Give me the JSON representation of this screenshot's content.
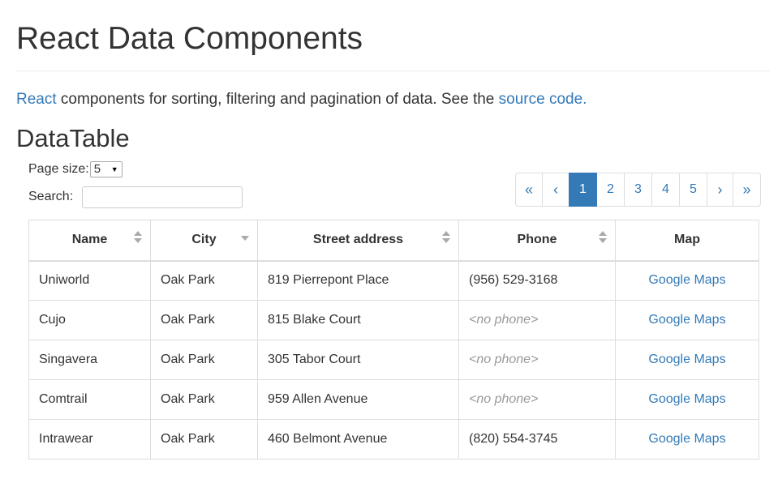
{
  "header": {
    "title": "React Data Components"
  },
  "intro": {
    "react_link": "React",
    "text": " components for sorting, filtering and pagination of data. See the ",
    "source_link": "source code."
  },
  "section": {
    "title": "DataTable"
  },
  "controls": {
    "page_size_label": "Page size:",
    "page_size_value": "5",
    "search_label": "Search:",
    "search_value": ""
  },
  "pagination": {
    "first": "«",
    "prev": "‹",
    "pages": [
      "1",
      "2",
      "3",
      "4",
      "5"
    ],
    "active_page": "1",
    "next": "›",
    "last": "»"
  },
  "table": {
    "columns": [
      {
        "label": "Name",
        "sort": "both"
      },
      {
        "label": "City",
        "sort": "descending"
      },
      {
        "label": "Street address",
        "sort": "both"
      },
      {
        "label": "Phone",
        "sort": "both"
      },
      {
        "label": "Map",
        "sort": "none"
      }
    ],
    "rows": [
      {
        "name": "Uniworld",
        "city": "Oak Park",
        "street": "819 Pierrepont Place",
        "phone": "(956) 529-3168",
        "map": "Google Maps"
      },
      {
        "name": "Cujo",
        "city": "Oak Park",
        "street": "815 Blake Court",
        "phone": "<no phone>",
        "map": "Google Maps"
      },
      {
        "name": "Singavera",
        "city": "Oak Park",
        "street": "305 Tabor Court",
        "phone": "<no phone>",
        "map": "Google Maps"
      },
      {
        "name": "Comtrail",
        "city": "Oak Park",
        "street": "959 Allen Avenue",
        "phone": "<no phone>",
        "map": "Google Maps"
      },
      {
        "name": "Intrawear",
        "city": "Oak Park",
        "street": "460 Belmont Avenue",
        "phone": "(820) 554-3745",
        "map": "Google Maps"
      }
    ]
  },
  "colors": {
    "link": "#337ab7",
    "active_page_bg": "#337ab7",
    "border": "#dddddd",
    "muted": "#999999",
    "text": "#333333"
  }
}
